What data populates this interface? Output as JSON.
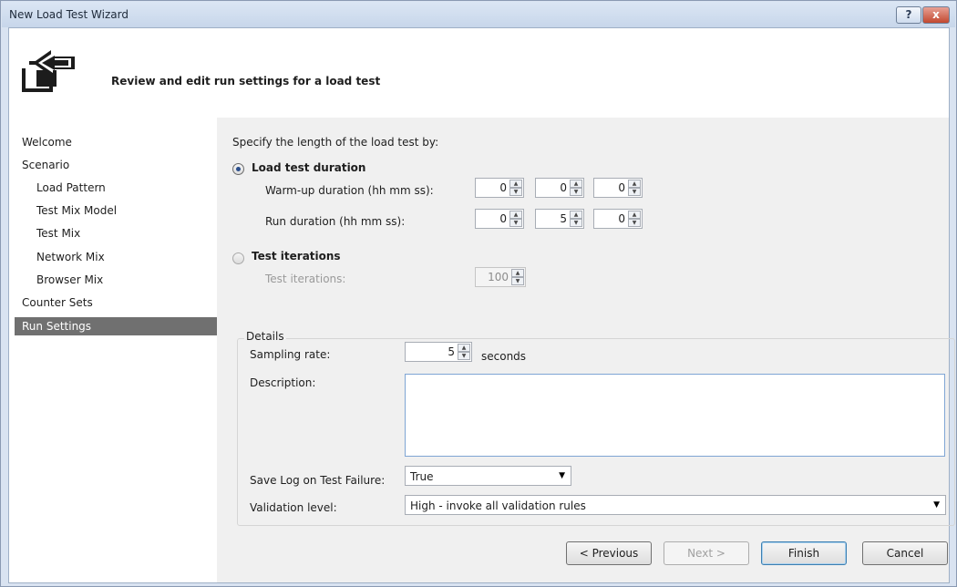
{
  "window": {
    "title": "New Load Test Wizard",
    "help_label": "?",
    "close_label": "x"
  },
  "header": {
    "title": "Review and edit run settings for a load test",
    "icon": "wizard-import-icon"
  },
  "sidebar": {
    "items": [
      {
        "label": "Welcome"
      },
      {
        "label": "Scenario"
      },
      {
        "label": "Load Pattern"
      },
      {
        "label": "Test Mix Model"
      },
      {
        "label": "Test Mix"
      },
      {
        "label": "Network Mix"
      },
      {
        "label": "Browser Mix"
      },
      {
        "label": "Counter Sets"
      },
      {
        "label": "Run Settings"
      }
    ],
    "selected": "Run Settings"
  },
  "main": {
    "intro": "Specify the length of the load test by:",
    "duration_option": {
      "label": "Load test duration",
      "selected": true,
      "warmup_label": "Warm-up duration (hh mm ss):",
      "warmup_values": [
        "0",
        "0",
        "0"
      ],
      "run_label": "Run duration (hh mm ss):",
      "run_values": [
        "0",
        "5",
        "0"
      ]
    },
    "iterations_option": {
      "label": "Test iterations",
      "selected": false,
      "field_label": "Test iterations:",
      "field_value": "100"
    },
    "details": {
      "title": "Details",
      "sampling_label": "Sampling rate:",
      "sampling_value": "5",
      "sampling_unit": "seconds",
      "description_label": "Description:",
      "description_value": "",
      "savelog_label": "Save Log on Test Failure:",
      "savelog_value": "True",
      "validation_label": "Validation level:",
      "validation_value": "High - invoke all validation rules"
    }
  },
  "footer": {
    "previous_label": "< Previous",
    "next_label": "Next >",
    "finish_label": "Finish",
    "cancel_label": "Cancel"
  },
  "colors": {
    "selection": "#707070",
    "panel": "#f0f0f0",
    "focus_border": "#7fa5d4"
  }
}
